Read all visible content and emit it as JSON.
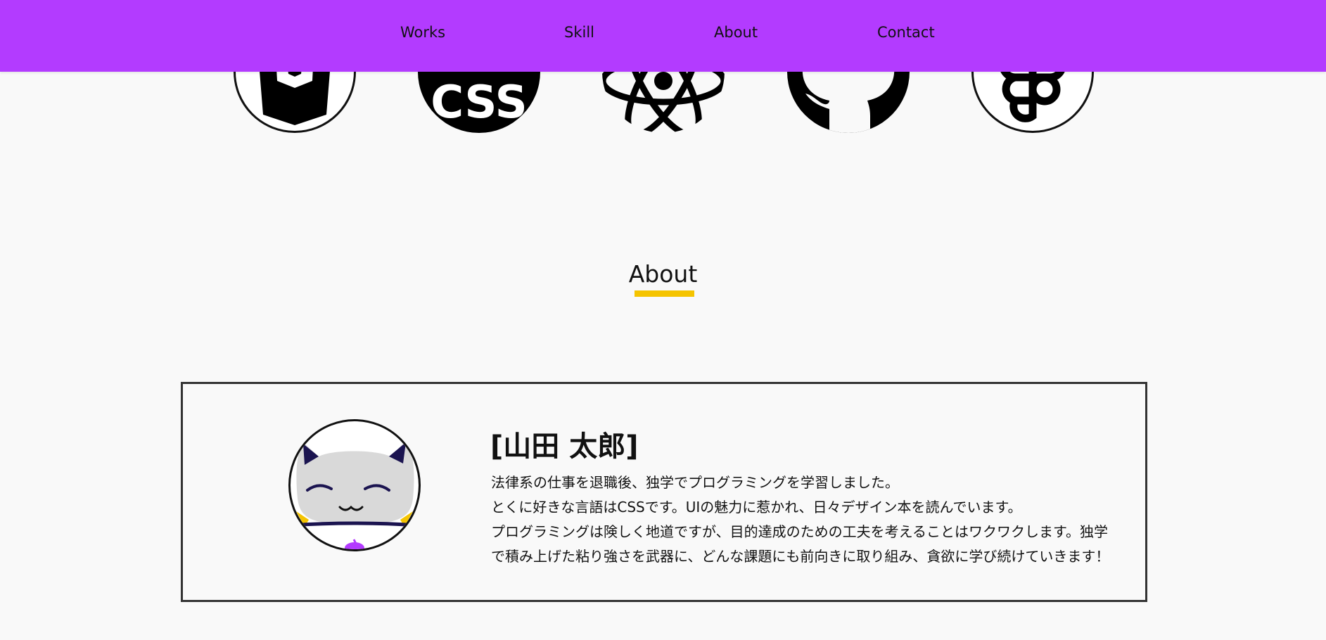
{
  "nav": {
    "items": [
      {
        "label": "Works"
      },
      {
        "label": "Skill"
      },
      {
        "label": "About"
      },
      {
        "label": "Contact"
      }
    ]
  },
  "skills": {
    "icons": [
      "html5-icon",
      "css-icon",
      "react-icon",
      "github-icon",
      "figma-icon"
    ],
    "css_label": "CSS"
  },
  "about": {
    "title": "About",
    "name": "[山田 太郎]",
    "bio_lines": [
      "法律系の仕事を退職後、独学でプログラミングを学習しました。",
      "とくに好きな言語はCSSです。UIの魅力に惹かれ、日々デザイン本を読んでいます。",
      "プログラミングは険しく地道ですが、目的達成のための工夫を考えることはワクワクします。独学",
      "で積み上げた粘り強さを武器に、どんな課題にも前向きに取り組み、貪欲に学び続けていきます！"
    ]
  },
  "colors": {
    "header": "#b33bff",
    "underline": "#f5c400",
    "background": "#f9f9f9"
  }
}
